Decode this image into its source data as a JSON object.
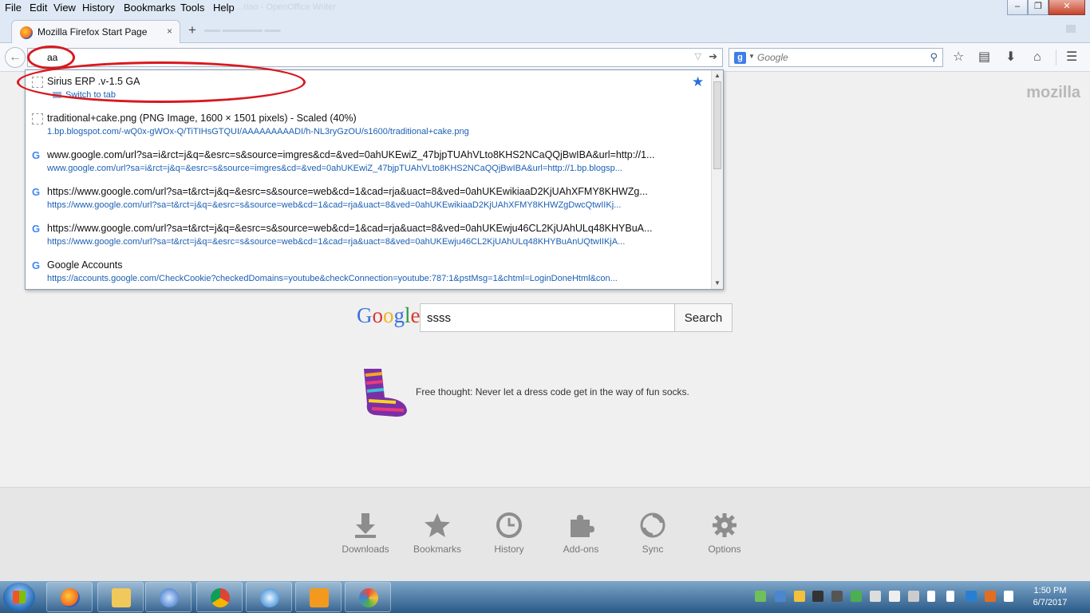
{
  "menubar": {
    "items": [
      "File",
      "Edit",
      "View",
      "History",
      "Bookmarks",
      "Tools",
      "Help"
    ],
    "ghost_title": "...riao - OpenOffice Writer"
  },
  "tab": {
    "title": "Mozilla Firefox Start Page",
    "close": "×",
    "new_tab": "+"
  },
  "urlbar": {
    "value": "aa"
  },
  "searchbar": {
    "engine_icon": "g",
    "placeholder": "Google"
  },
  "autocomplete": [
    {
      "icon": "blank",
      "title": "Sirius ERP .v-1.5 GA",
      "url": "",
      "action": "Switch to tab",
      "starred": true
    },
    {
      "icon": "blank",
      "title": "traditional+cake.png (PNG Image, 1600 × 1501 pixels) - Scaled (40%)",
      "url": "1.bp.blogspot.com/-wQ0x-gWOx-Q/TiTIHsGTQUI/AAAAAAAAADI/h-NL3ryGzOU/s1600/traditional+cake.png",
      "action": "",
      "starred": false
    },
    {
      "icon": "google",
      "title": "www.google.com/url?sa=i&rct=j&q=&esrc=s&source=imgres&cd=&ved=0ahUKEwiZ_47bjpTUAhVLto8KHS2NCaQQjBwIBA&url=http://1...",
      "url": "www.google.com/url?sa=i&rct=j&q=&esrc=s&source=imgres&cd=&ved=0ahUKEwiZ_47bjpTUAhVLto8KHS2NCaQQjBwIBA&url=http://1.bp.blogsp...",
      "action": "",
      "starred": false
    },
    {
      "icon": "google",
      "title": "https://www.google.com/url?sa=t&rct=j&q=&esrc=s&source=web&cd=1&cad=rja&uact=8&ved=0ahUKEwikiaaD2KjUAhXFMY8KHWZg...",
      "url": "https://www.google.com/url?sa=t&rct=j&q=&esrc=s&source=web&cd=1&cad=rja&uact=8&ved=0ahUKEwikiaaD2KjUAhXFMY8KHWZgDwcQtwIIKj...",
      "action": "",
      "starred": false
    },
    {
      "icon": "google",
      "title": "https://www.google.com/url?sa=t&rct=j&q=&esrc=s&source=web&cd=1&cad=rja&uact=8&ved=0ahUKEwju46CL2KjUAhULq48KHYBuA...",
      "url": "https://www.google.com/url?sa=t&rct=j&q=&esrc=s&source=web&cd=1&cad=rja&uact=8&ved=0ahUKEwju46CL2KjUAhULq48KHYBuAnUQtwIIKjA...",
      "action": "",
      "starred": false
    },
    {
      "icon": "google",
      "title": "Google Accounts",
      "url": "https://accounts.google.com/CheckCookie?checkedDomains=youtube&checkConnection=youtube:787:1&pstMsg=1&chtml=LoginDoneHtml&con...",
      "action": "",
      "starred": false
    }
  ],
  "page": {
    "brand": "mozilla",
    "google_letters": [
      "G",
      "o",
      "o",
      "g",
      "l",
      "e"
    ],
    "search_value": "ssss",
    "search_button": "Search",
    "thought": "Free thought: Never let a dress code get in the way of fun socks.",
    "launcher": [
      "Downloads",
      "Bookmarks",
      "History",
      "Add-ons",
      "Sync",
      "Options"
    ]
  },
  "taskbar": {
    "time": "1:50 PM",
    "date": "6/7/2017"
  },
  "colors": {
    "link": "#1a5fb4",
    "annotation": "#d7191f",
    "star": "#2a6fd6"
  }
}
